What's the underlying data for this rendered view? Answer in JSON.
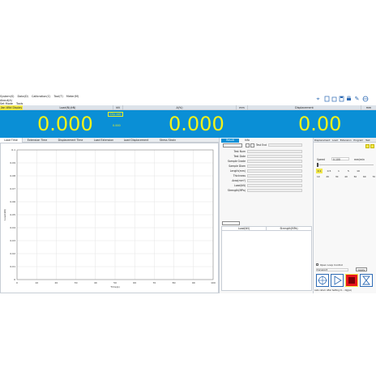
{
  "menu": {
    "items": [
      "System(S)",
      "Data(D)",
      "Calibration(C)",
      "Tool(T)",
      "Meter(M)",
      "About(A)"
    ],
    "sub_items": [
      "Set Mode",
      "Tools"
    ]
  },
  "toolbar": {
    "icons": [
      "location-icon",
      "new-file-icon",
      "open-file-icon",
      "save-icon",
      "print-icon",
      "edit-icon",
      "exit-icon"
    ]
  },
  "channels": {
    "mode_label": "Jlan Wild Display",
    "ch1": {
      "label": "Load(N)(kN)",
      "unit": "kN",
      "value": "0.000",
      "tag": "Clip ext",
      "sub": "0.000"
    },
    "ch2": {
      "label": "Δ(%)",
      "unit": "mm",
      "value": "0.000"
    },
    "ch3": {
      "label": "Displacement",
      "unit": "mm",
      "value": "0.00"
    }
  },
  "chart_tabs": [
    "Load Time",
    "Extension Time",
    "Displacement Time",
    "Load Extension",
    "Load Displacement",
    "Stress Strain"
  ],
  "chart_data": {
    "type": "line",
    "x": [],
    "series": [],
    "xlabel": "Time(s)",
    "ylabel": "Load(kN)",
    "xlim": [
      0,
      100
    ],
    "ylim": [
      0,
      0.1
    ],
    "xticks": [
      "0",
      "10",
      "20",
      "30",
      "40",
      "50",
      "60",
      "70",
      "80",
      "90",
      "100"
    ],
    "yticks": [
      "0",
      "0.01",
      "0.02",
      "0.03",
      "0.04",
      "0.05",
      "0.06",
      "0.07",
      "0.08",
      "0.09",
      "0.1"
    ],
    "grid": true
  },
  "results": {
    "tabs": [
      "Result",
      "Info"
    ],
    "test_end": "Test End",
    "fields": [
      "Test Num",
      "Test Date",
      "Sample Grade",
      "Sample Diam",
      "Length(mm)",
      "Thickness",
      "Area(mm²)",
      "Load(kN)",
      "Strength(MPa)"
    ],
    "table_headers": [
      "Load(kN)",
      "Strength(MPa)"
    ]
  },
  "control": {
    "tabs": [
      "Displacement",
      "Load",
      "Extension",
      "Program",
      "Test"
    ],
    "speed_label": "Speed",
    "speed_value": "0.100",
    "speed_unit": "mm/min",
    "presets": [
      "0.1",
      "0.5",
      "1",
      "5",
      "10"
    ],
    "scale": [
      "10",
      "20",
      "30",
      "40",
      "50",
      "60",
      "70"
    ],
    "open_loop": "Open Loop Control",
    "transport_label": "Transport",
    "apply_label": "Apply",
    "footer": "Auto return  After  Setting  Cl... dlg(pz)"
  },
  "colors": {
    "display_bg": "#0a8fd6",
    "digits": "#f2f21a",
    "stop": "#e8141c",
    "mode_btn": "#f1e84b"
  }
}
